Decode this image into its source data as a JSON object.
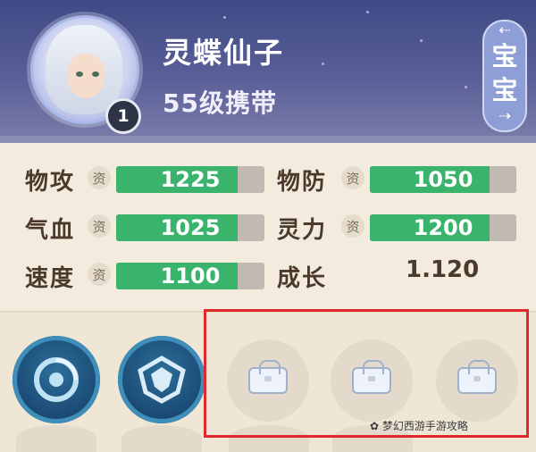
{
  "header": {
    "pet_name": "灵蝶仙子",
    "level_text": "55级携带",
    "avatar_badge": "1",
    "side_tab_label_1": "宝",
    "side_tab_label_2": "宝",
    "side_tab_arrow_top": "⇠",
    "side_tab_arrow_bottom": "⇢"
  },
  "stats": {
    "aptitude_icon_label": "资",
    "items": [
      {
        "label": "物攻",
        "value": "1225",
        "fill": 0.82
      },
      {
        "label": "物防",
        "value": "1050",
        "fill": 0.82
      },
      {
        "label": "气血",
        "value": "1025",
        "fill": 0.82
      },
      {
        "label": "灵力",
        "value": "1200",
        "fill": 0.82
      },
      {
        "label": "速度",
        "value": "1100",
        "fill": 0.82
      }
    ],
    "growth_label": "成长",
    "growth_value": "1.120"
  },
  "skills": {
    "slots": [
      {
        "state": "active",
        "icon": "shield-swirl-icon"
      },
      {
        "state": "active",
        "icon": "crest-icon"
      },
      {
        "state": "locked",
        "icon": "lock-icon"
      },
      {
        "state": "locked",
        "icon": "lock-icon"
      },
      {
        "state": "locked",
        "icon": "lock-icon"
      }
    ]
  },
  "watermark": "✿ 梦幻西游手游攻略",
  "colors": {
    "bar_fill": "#3ab46c",
    "bar_track": "#c0bab3",
    "highlight_border": "#e0292c",
    "header_bg": "#4a5490"
  }
}
